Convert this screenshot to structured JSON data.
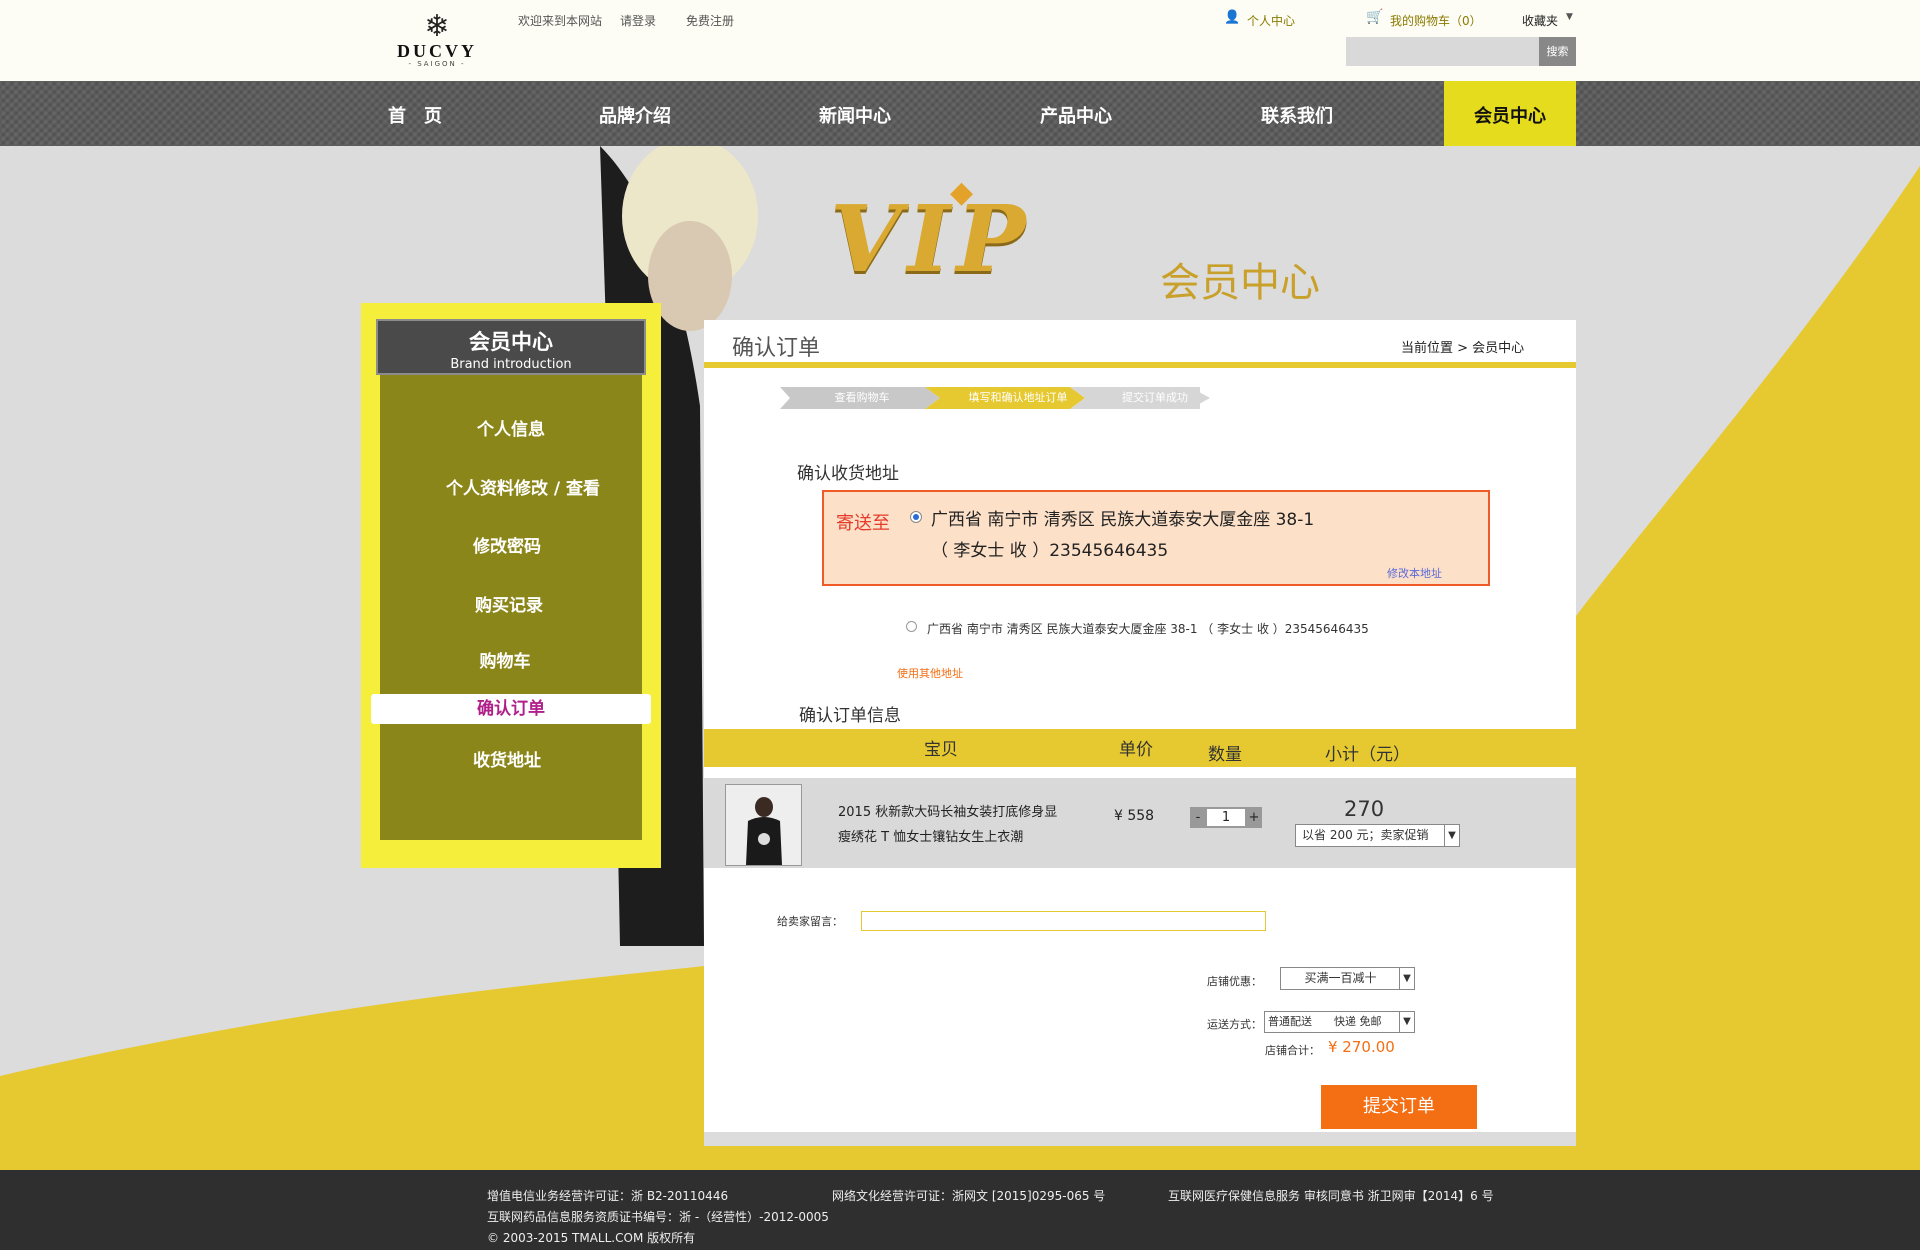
{
  "header": {
    "logo_brand": "DUCVY",
    "logo_sub": "- SAIGON -",
    "welcome": "欢迎来到本网站",
    "login": "请登录",
    "register": "免费注册",
    "personal_center": "个人中心",
    "cart": "我的购物车（0）",
    "favorites": "收藏夹",
    "search_button": "搜索"
  },
  "nav": {
    "items": [
      "首　页",
      "品牌介绍",
      "新闻中心",
      "产品中心",
      "联系我们",
      "会员中心"
    ],
    "active": "会员中心"
  },
  "banner": {
    "vip_text": "VIP",
    "title": "会员中心"
  },
  "sidebar": {
    "title": "会员中心",
    "subtitle": "Brand introduction",
    "items": [
      "个人信息",
      "个人资料修改 / 查看",
      "修改密码",
      "购买记录",
      "购物车",
      "确认订单",
      "收货地址"
    ],
    "active": "确认订单"
  },
  "main": {
    "title": "确认订单",
    "breadcrumb": "当前位置 > 会员中心",
    "steps": [
      "查看购物车",
      "填写和确认地址订单",
      "提交订单成功"
    ],
    "address_section": "确认收货地址",
    "ship_to": "寄送至",
    "address_line1": "广西省 南宁市 清秀区 民族大道泰安大厦金座 38-1",
    "address_line2": "（ 李女士 收 ）23545646435",
    "edit_address": "修改本地址",
    "alt_address": "广西省 南宁市 清秀区 民族大道泰安大厦金座 38-1 （ 李女士 收 ）23545646435",
    "use_other_address": "使用其他地址",
    "order_section": "确认订单信息",
    "columns": [
      "宝贝",
      "单价",
      "数量",
      "小计（元）"
    ],
    "item": {
      "name_line1": "2015 秋新款大码长袖女装打底修身显",
      "name_line2": "瘦绣花 T 恤女士镶钻女生上衣潮",
      "price": "¥ 558",
      "qty": "1",
      "minus": "-",
      "plus": "+",
      "subtotal": "270",
      "promo": "以省 200 元；卖家促销"
    },
    "message_label": "给卖家留言：",
    "message_value": "",
    "shop_discount_label": "店铺优惠：",
    "shop_discount_value": "买满一百减十",
    "shipping_label": "运送方式：",
    "shipping_value": "普通配送　　快递  免邮",
    "shop_total_label": "店铺合计：",
    "shop_total_value": "¥ 270.00",
    "submit": "提交订单"
  },
  "footer": {
    "line1_a": "增值电信业务经营许可证：浙 B2-20110446",
    "line1_b": "网络文化经营许可证：浙网文 [2015]0295-065 号",
    "line1_c": "互联网医疗保健信息服务 审核同意书 浙卫网审【2014】6 号",
    "line2": "互联网药品信息服务资质证书编号：浙 -（经营性）-2012-0005",
    "line3": "© 2003-2015 TMALL.COM 版权所有"
  },
  "colors": {
    "accent_yellow": "#e6c930",
    "nav_gray": "#5d5d5d",
    "submit_orange": "#f46e14",
    "active_pink": "#b0208a"
  }
}
